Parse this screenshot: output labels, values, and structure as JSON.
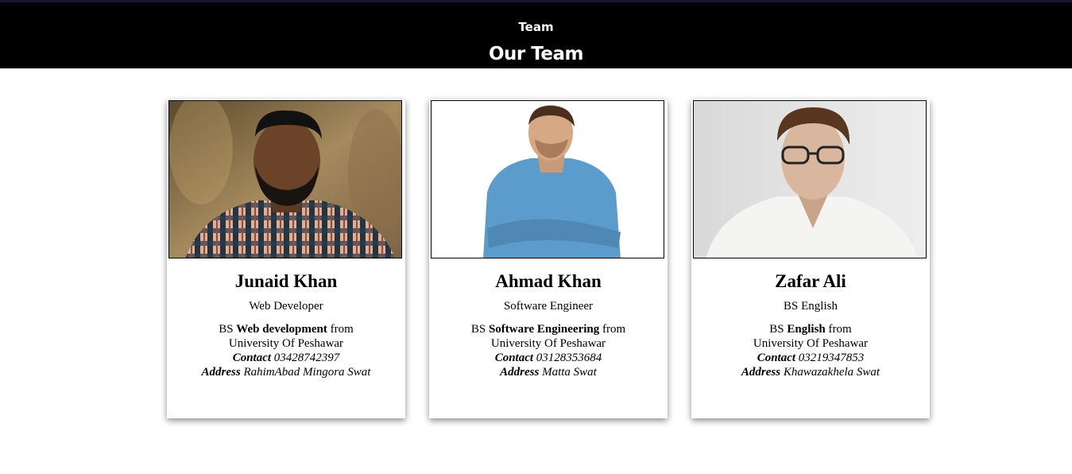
{
  "header": {
    "nav_title": "Team",
    "page_title": "Our Team",
    "background": "#000000"
  },
  "members": [
    {
      "name": "Junaid Khan",
      "role": "Web Developer",
      "degree_prefix": "BS",
      "degree_field": "Web development",
      "degree_suffix": "from",
      "university": "University Of Peshawar",
      "contact_label": "Contact",
      "contact": "03428742397",
      "address_label": "Address",
      "address": "RahimAbad Mingora Swat",
      "photo_icon": "person-photo-plaid-shirt"
    },
    {
      "name": "Ahmad Khan",
      "role": "Software Engineer",
      "degree_prefix": "BS",
      "degree_field": "Software Engineering",
      "degree_suffix": "from",
      "university": "University Of Peshawar",
      "contact_label": "Contact",
      "contact": "03128353684",
      "address_label": "Address",
      "address": "Matta Swat",
      "photo_icon": "person-photo-denim-shirt"
    },
    {
      "name": "Zafar Ali",
      "role": "BS English",
      "degree_prefix": "BS",
      "degree_field": "English",
      "degree_suffix": "from",
      "university": "University Of Peshawar",
      "contact_label": "Contact",
      "contact": "03219347853",
      "address_label": "Address",
      "address": "Khawazakhela Swat",
      "photo_icon": "person-photo-white-shirt-glasses"
    }
  ]
}
